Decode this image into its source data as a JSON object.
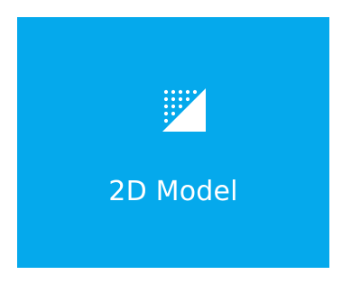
{
  "tile": {
    "label": "2D Model",
    "icon": "2d-model-icon",
    "background_color": "#05a9ec",
    "foreground_color": "#ffffff"
  }
}
